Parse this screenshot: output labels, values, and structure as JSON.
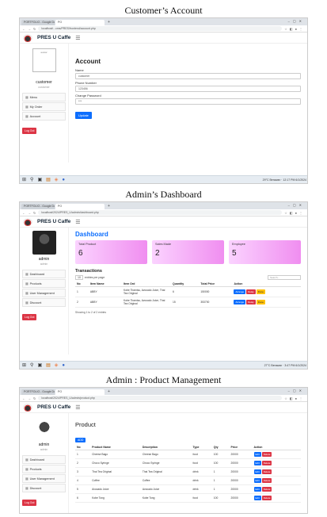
{
  "captions": {
    "account": "Customer’s Account",
    "dashboard": "Admin’s Dashboard",
    "product": "Admin : Product Management"
  },
  "browser": {
    "tab1": "PORTFOLIO - Google Docs",
    "tab2": "PO",
    "url_account": "localhost/...cms/PRES/frontend/account.php",
    "url_dashboard": "localhost/2024/PRES_U/admin/dashboard.php",
    "url_product": "localhost/2024/PRES_U/admin/product.php"
  },
  "app": {
    "brand": "PRES U Caffe"
  },
  "account": {
    "avatar_alt": "avatar",
    "user_name": "customer",
    "user_role": "customer",
    "menu": [
      "Menu",
      "My Order",
      "Account"
    ],
    "logout": "Log Out",
    "title": "Account",
    "fields": [
      {
        "label": "Name",
        "value": "customer"
      },
      {
        "label": "Phone Number",
        "value": "123456"
      },
      {
        "label": "Change Password",
        "value": "***"
      }
    ],
    "update": "Update"
  },
  "dashboard": {
    "user_name": "admin",
    "user_role": "admin",
    "menu": [
      "Dashboard",
      "Products",
      "User Management",
      "Discount"
    ],
    "logout": "Log Out",
    "title": "Dashboard",
    "cards": [
      {
        "label": "Total Product",
        "value": "6"
      },
      {
        "label": "Sales Made",
        "value": "2"
      },
      {
        "label": "Employee",
        "value": "5"
      }
    ],
    "tx_title": "Transactions",
    "entries_select": "10",
    "entries_label": "entries per page",
    "search_placeholder": "Search...",
    "columns": [
      "No",
      "Item Name",
      "Item Ord",
      "Quantity",
      "Total Price",
      "Action"
    ],
    "rows": [
      [
        "1",
        "ABBY",
        "Kobe Tiramisu, Avocado Juice, Thai Tea Original",
        "6",
        "150000"
      ],
      [
        "2",
        "ABBY",
        "Kobe Tiramisu, Avocado Juice, Thai Tea Original",
        "15",
        "353700"
      ]
    ],
    "actions": [
      "Arrange",
      "Delay",
      "Done"
    ],
    "showing": "Showing 1 to 2 of 2 entries"
  },
  "product": {
    "user_name": "admin",
    "user_role": "admin",
    "menu": [
      "Dashboard",
      "Products",
      "User Management",
      "Discount"
    ],
    "logout": "Log Out",
    "title": "Product",
    "add": "ADD",
    "columns": [
      "No",
      "Product Name",
      "Description",
      "Type",
      "Qty",
      "Price",
      "Action"
    ],
    "rows": [
      [
        "1",
        "Cheese Bago",
        "Cheese Bago",
        "food",
        "100",
        "20000"
      ],
      [
        "2",
        "Choco Syringe",
        "Choco Syringe",
        "food",
        "100",
        "20000"
      ],
      [
        "3",
        "Thai Tea Original",
        "Thai Tea Original",
        "drink",
        "1",
        "20000"
      ],
      [
        "4",
        "Coffee",
        "Coffee",
        "drink",
        "1",
        "20000"
      ],
      [
        "5",
        "Avocado Juice",
        "Avocado Juice",
        "drink",
        "1",
        "20000"
      ],
      [
        "6",
        "Kobe Tong",
        "Kobe Tong",
        "food",
        "100",
        "20000"
      ]
    ],
    "edit": "Edit",
    "delete": "Delete"
  },
  "taskbar": {
    "weather1": "29°C Berawan",
    "time1": "12:17 PM",
    "date1": "6/1/2024",
    "weather2": "27°C Berawan",
    "time2": "3:47 PM",
    "date2": "6/1/2024"
  }
}
